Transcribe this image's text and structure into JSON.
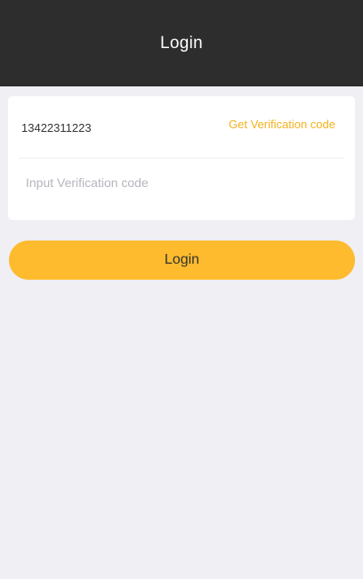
{
  "header": {
    "title": "Login"
  },
  "form": {
    "phone_value": "13422311223",
    "get_code_label": "Get Verification code",
    "code_placeholder": "Input Verification code",
    "code_value": ""
  },
  "actions": {
    "login_label": "Login"
  },
  "colors": {
    "header_bg": "#2d2d2d",
    "accent": "#fdbb2d",
    "link": "#f2b21f",
    "page_bg": "#efeff4"
  }
}
